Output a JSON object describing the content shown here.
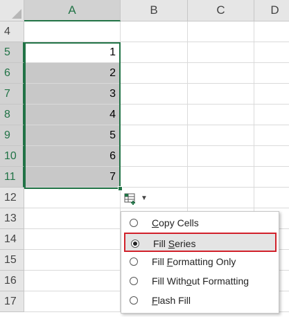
{
  "columns": [
    {
      "label": "A",
      "selected": true
    },
    {
      "label": "B",
      "selected": false
    },
    {
      "label": "C",
      "selected": false
    },
    {
      "label": "D",
      "selected": false
    }
  ],
  "rows": [
    {
      "num": "4",
      "selected": false,
      "a": ""
    },
    {
      "num": "5",
      "selected": true,
      "a": "1"
    },
    {
      "num": "6",
      "selected": true,
      "a": "2"
    },
    {
      "num": "7",
      "selected": true,
      "a": "3"
    },
    {
      "num": "8",
      "selected": true,
      "a": "4"
    },
    {
      "num": "9",
      "selected": true,
      "a": "5"
    },
    {
      "num": "10",
      "selected": true,
      "a": "6"
    },
    {
      "num": "11",
      "selected": true,
      "a": "7"
    },
    {
      "num": "12",
      "selected": false,
      "a": ""
    },
    {
      "num": "13",
      "selected": false,
      "a": ""
    },
    {
      "num": "14",
      "selected": false,
      "a": ""
    },
    {
      "num": "15",
      "selected": false,
      "a": ""
    },
    {
      "num": "16",
      "selected": false,
      "a": ""
    },
    {
      "num": "17",
      "selected": false,
      "a": ""
    }
  ],
  "autofill_menu": {
    "items": [
      {
        "pre": "",
        "key": "C",
        "post": "opy Cells",
        "checked": false
      },
      {
        "pre": "Fill ",
        "key": "S",
        "post": "eries",
        "checked": true
      },
      {
        "pre": "Fill ",
        "key": "F",
        "post": "ormatting Only",
        "checked": false
      },
      {
        "pre": "Fill With",
        "key": "o",
        "post": "ut Formatting",
        "checked": false
      },
      {
        "pre": "",
        "key": "F",
        "post": "lash Fill",
        "checked": false
      }
    ]
  },
  "colors": {
    "accent_green": "#217346",
    "highlight_red": "#d1202a",
    "selection_fill": "#c8c8c8"
  }
}
